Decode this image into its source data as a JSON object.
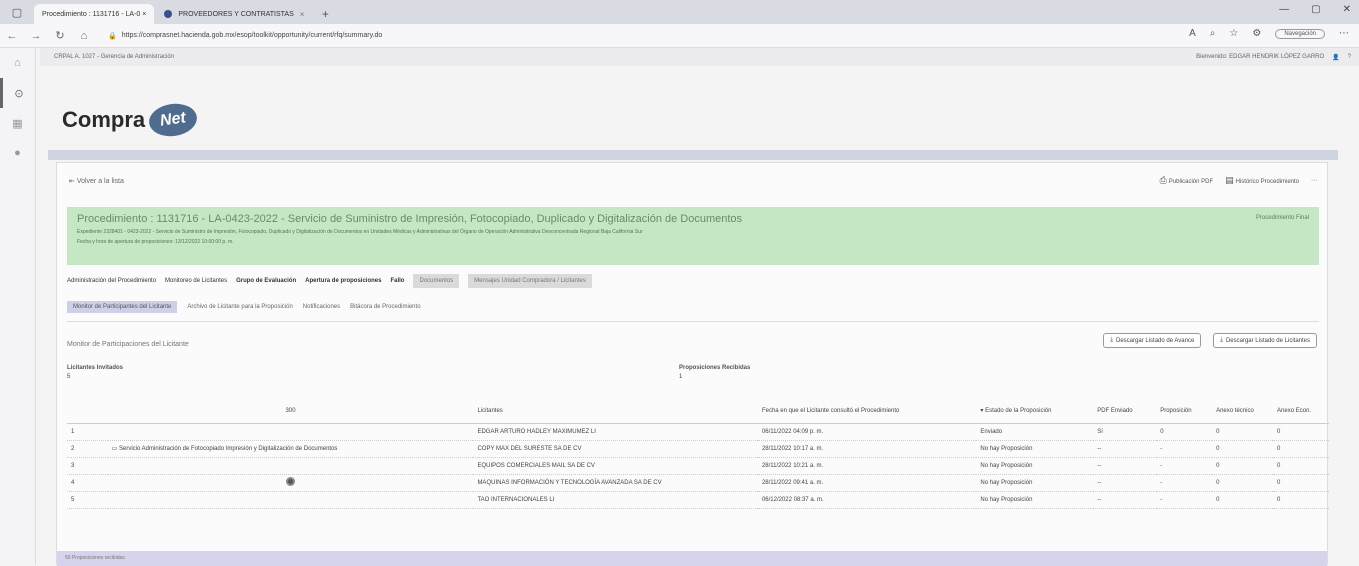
{
  "browser": {
    "tabs": [
      {
        "label": "Procedimiento : 1131716 - LA-0 ×"
      },
      {
        "label": "PROVEEDORES Y CONTRATISTAS"
      }
    ],
    "url": "https://comprasnet.hacienda.gob.mx/esop/toolkit/opportunity/current/rfq/summary.do",
    "search_pill": "Navegación"
  },
  "infobar": {
    "left": "CRPAL A. 1027 - Gerencia de Administración",
    "user": "Bienvenido: EDGAR HENDRIK LÓPEZ GARRO"
  },
  "logo": {
    "text": "Compra",
    "badge": "Net"
  },
  "page": {
    "back": "Volver a la lista",
    "tools": [
      "Publicación PDF",
      "Histórico Procedimiento"
    ],
    "procedure_title": "Procedimiento : 1131716 - LA-0423-2022 - Servicio de Suministro de Impresión, Fotocopiado, Duplicado y Digitalización de Documentos",
    "procedure_right": "Procedimiento Final",
    "procedure_line1": "Expediente 2328401 - 0423-2022 - Servicio de Suministro de Impresión, Fotocopiado, Duplicado y Digitalización de Documentos en Unidades Médicas y Administrativas del Órgano de Operación Administrativa Desconcentrada Regional Baja California Sur",
    "procedure_line2": "Fecha y hora de apertura de proposiciones: 13/12/2022 10:00:00 p. m.",
    "tabs_main": [
      "Administración del Procedimiento",
      "Monitoreo de Licitantes",
      "Grupo de Evaluación",
      "Apertura de proposiciones",
      "Fallo",
      "Documentos",
      "Mensajes Unidad Compradora / Licitantes"
    ],
    "tabs_sub": [
      "Monitor de Participantes del Licitante",
      "Archivo de Licitante para la Proposición",
      "Notificaciones",
      "Bitácora de Procedimiento"
    ],
    "section_title": "Monitor de Participaciones del Licitante",
    "action_buttons": [
      "Descargar Listado de Avance",
      "Descargar Listado de Licitantes"
    ],
    "stats": {
      "invited_label": "Licitantes Invitados",
      "invited_value": "5",
      "received_label": "Proposiciones Recibidas",
      "received_value": "1"
    },
    "table": {
      "headers": [
        "",
        "300",
        "Licitantes",
        "Fecha en que el Licitante consultó el Procedimiento",
        "▾ Estado de la Proposición",
        "PDF Enviado",
        "Proposición",
        "Anexo técnico",
        "Anexo Econ."
      ],
      "rows": [
        {
          "num": "1",
          "doc": "",
          "lic": "EDGAR ARTURO HADLEY MAXIMUMEZ LI",
          "fecha": "06/11/2022 04:09 p. m.",
          "estado": "Enviado",
          "pdf": "Sí",
          "prop": "0",
          "at": "0",
          "ae": "0"
        },
        {
          "num": "2",
          "doc": "Servicio Administración de Fotocopiado Impresión y Digitalización de Documentos",
          "lic": "COPY MAX DEL SURESTE SA DE CV",
          "fecha": "28/11/2022 10:17 a. m.",
          "estado": "No hay Proposición",
          "pdf": "--",
          "prop": "-",
          "at": "0",
          "ae": "0"
        },
        {
          "num": "3",
          "doc": "",
          "lic": "EQUIPOS COMERCIALES MAIL SA DE CV",
          "fecha": "28/11/2022 10:21 a. m.",
          "estado": "No hay Proposición",
          "pdf": "--",
          "prop": "-",
          "at": "0",
          "ae": "0"
        },
        {
          "num": "4",
          "doc": "",
          "lic": "MAQUINAS INFORMACIÓN Y TECNOLOGÍA AVANZADA SA DE CV",
          "fecha": "28/11/2022 09:41 a. m.",
          "estado": "No hay Proposición",
          "pdf": "--",
          "prop": "-",
          "at": "0",
          "ae": "0"
        },
        {
          "num": "5",
          "doc": "",
          "lic": "TAO INTERNACIONALES LI",
          "fecha": "06/12/2022 08:37 a. m.",
          "estado": "No hay Proposición",
          "pdf": "--",
          "prop": "-",
          "at": "0",
          "ae": "0"
        }
      ]
    },
    "footer": "50 Proposiciones recibidas"
  }
}
